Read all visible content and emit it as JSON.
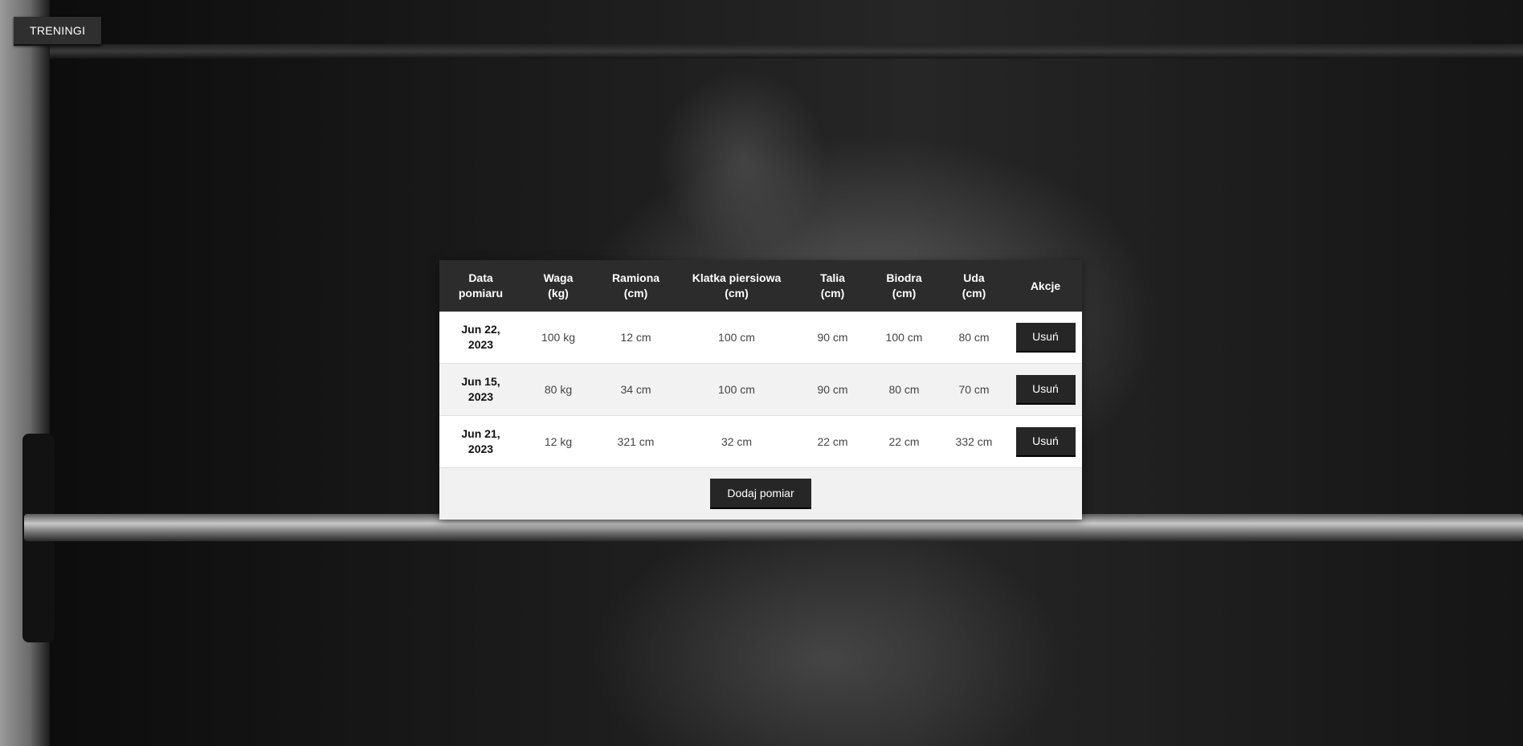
{
  "nav": {
    "trainings_label": "TRENINGI"
  },
  "table": {
    "headers": {
      "date": [
        "Data",
        "pomiaru"
      ],
      "weight": [
        "Waga",
        "(kg)"
      ],
      "arms": [
        "Ramiona",
        "(cm)"
      ],
      "chest": [
        "Klatka piersiowa",
        "(cm)"
      ],
      "waist": [
        "Talia",
        "(cm)"
      ],
      "hips": [
        "Biodra",
        "(cm)"
      ],
      "thighs": [
        "Uda",
        "(cm)"
      ],
      "actions": "Akcje"
    },
    "rows": [
      {
        "date": [
          "Jun 22,",
          "2023"
        ],
        "weight": "100 kg",
        "arms": "12 cm",
        "chest": "100 cm",
        "waist": "90 cm",
        "hips": "100 cm",
        "thighs": "80 cm",
        "action_label": "Usuń"
      },
      {
        "date": [
          "Jun 15,",
          "2023"
        ],
        "weight": "80 kg",
        "arms": "34 cm",
        "chest": "100 cm",
        "waist": "90 cm",
        "hips": "80 cm",
        "thighs": "70 cm",
        "action_label": "Usuń"
      },
      {
        "date": [
          "Jun 21,",
          "2023"
        ],
        "weight": "12 kg",
        "arms": "321 cm",
        "chest": "32 cm",
        "waist": "22 cm",
        "hips": "22 cm",
        "thighs": "332 cm",
        "action_label": "Usuń"
      }
    ]
  },
  "footer": {
    "add_label": "Dodaj pomiar"
  },
  "colors": {
    "header_bg": "#2c2c2c",
    "button_bg": "#262626",
    "row_alt": "#f2f2f2"
  }
}
